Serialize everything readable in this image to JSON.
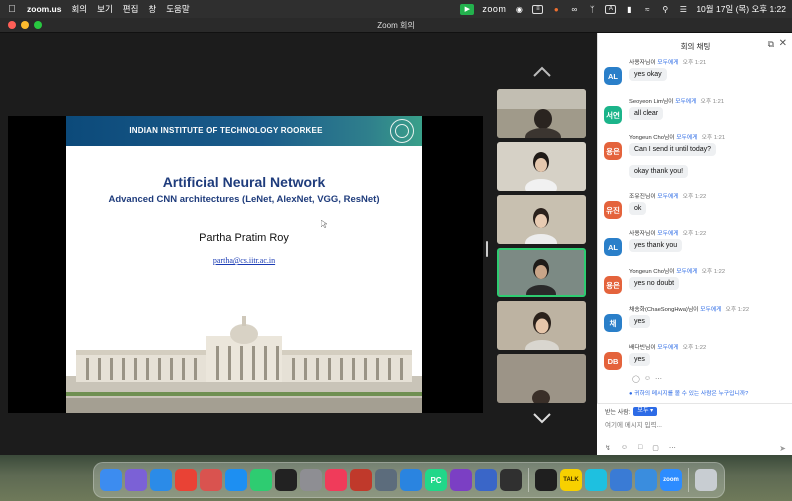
{
  "menubar": {
    "app_name": "zoom.us",
    "menus": [
      "회의",
      "보기",
      "편집",
      "창",
      "도움말"
    ],
    "status_app": "zoom",
    "clock": "10월 17일 (목) 오후 1:22"
  },
  "window": {
    "title": "Zoom 회의"
  },
  "slide": {
    "institute": "INDIAN INSTITUTE OF TECHNOLOGY ROORKEE",
    "title": "Artificial Neural Network",
    "subtitle": "Advanced CNN architectures (LeNet, AlexNet, VGG, ResNet)",
    "author": "Partha Pratim Roy",
    "email": "partha@cs.iitr.ac.in"
  },
  "chat": {
    "title": "회의 채팅",
    "messages": [
      {
        "avatar": "AL",
        "avatar_color": "#2a7fc9",
        "sender": "사용자님이",
        "to": "모두에게",
        "time": "오후 1:21",
        "texts": [
          "yes okay"
        ]
      },
      {
        "avatar": "서연",
        "avatar_color": "#1bb48a",
        "sender": "Seoyeon Lim님이",
        "to": "모두에게",
        "time": "오후 1:21",
        "texts": [
          "all clear"
        ]
      },
      {
        "avatar": "용은",
        "avatar_color": "#e4633c",
        "sender": "Yongeun Cho님이",
        "to": "모두에게",
        "time": "오후 1:21",
        "texts": [
          "Can I send it until today?",
          "okay thank you!"
        ]
      },
      {
        "avatar": "유진",
        "avatar_color": "#e4633c",
        "sender": "조유진님이",
        "to": "모두에게",
        "time": "오후 1:22",
        "texts": [
          "ok"
        ]
      },
      {
        "avatar": "AL",
        "avatar_color": "#2a7fc9",
        "sender": "사용자님이",
        "to": "모두에게",
        "time": "오후 1:22",
        "texts": [
          "yes thank you"
        ]
      },
      {
        "avatar": "용은",
        "avatar_color": "#e4633c",
        "sender": "Yongeun Cho님이",
        "to": "모두에게",
        "time": "오후 1:22",
        "texts": [
          "yes no doubt"
        ]
      },
      {
        "avatar": "채",
        "avatar_color": "#2a7fc9",
        "sender": "채송화(ChaeSongHwa)님이",
        "to": "모두에게",
        "time": "오후 1:22",
        "texts": [
          "yes"
        ]
      },
      {
        "avatar": "DB",
        "avatar_color": "#e4633c",
        "sender": "배다빈님이",
        "to": "모두에게",
        "time": "오후 1:22",
        "texts": [
          "yes"
        ]
      }
    ],
    "who_can_see": "귀하의 메시지를 볼 수 있는 사람은 누구입니까?",
    "to_label": "받는 사람:",
    "to_value": "모두",
    "input_placeholder": "여기에 메시지 입력..."
  },
  "dock": {
    "apps": [
      {
        "name": "finder",
        "color": "#3c8cf0",
        "label": ""
      },
      {
        "name": "launchpad",
        "color": "#7b61d6",
        "label": ""
      },
      {
        "name": "safari",
        "color": "#2b8be8",
        "label": ""
      },
      {
        "name": "chrome",
        "color": "#e94235",
        "label": ""
      },
      {
        "name": "notes-app",
        "color": "#d9534f",
        "label": ""
      },
      {
        "name": "app-store",
        "color": "#1d8ff2",
        "label": ""
      },
      {
        "name": "facetime",
        "color": "#2ecc71",
        "label": ""
      },
      {
        "name": "clock",
        "color": "#222222",
        "label": ""
      },
      {
        "name": "settings",
        "color": "#8e8e93",
        "label": ""
      },
      {
        "name": "music",
        "color": "#f03b5a",
        "label": ""
      },
      {
        "name": "photo-booth",
        "color": "#c0392b",
        "label": ""
      },
      {
        "name": "system-preferences",
        "color": "#5c6c7c",
        "label": ""
      },
      {
        "name": "xcode",
        "color": "#2a84e0",
        "label": ""
      },
      {
        "name": "pycharm",
        "color": "#21d789",
        "label": "PC"
      },
      {
        "name": "visual-studio",
        "color": "#7b3fc4",
        "label": ""
      },
      {
        "name": "anki",
        "color": "#3a66c8",
        "label": ""
      },
      {
        "name": "obs",
        "color": "#303030",
        "label": ""
      },
      {
        "name": "terminal",
        "color": "#1f1f1f",
        "label": ""
      },
      {
        "name": "kakaotalk",
        "color": "#f7d000",
        "label": "TALK"
      },
      {
        "name": "discord",
        "color": "#1ec0e0",
        "label": ""
      },
      {
        "name": "files",
        "color": "#3a7bd5",
        "label": ""
      },
      {
        "name": "mail",
        "color": "#3a8dde",
        "label": ""
      },
      {
        "name": "zoom",
        "color": "#2d8cff",
        "label": "zoom"
      },
      {
        "name": "trash",
        "color": "#c8cdd2",
        "label": ""
      }
    ]
  }
}
